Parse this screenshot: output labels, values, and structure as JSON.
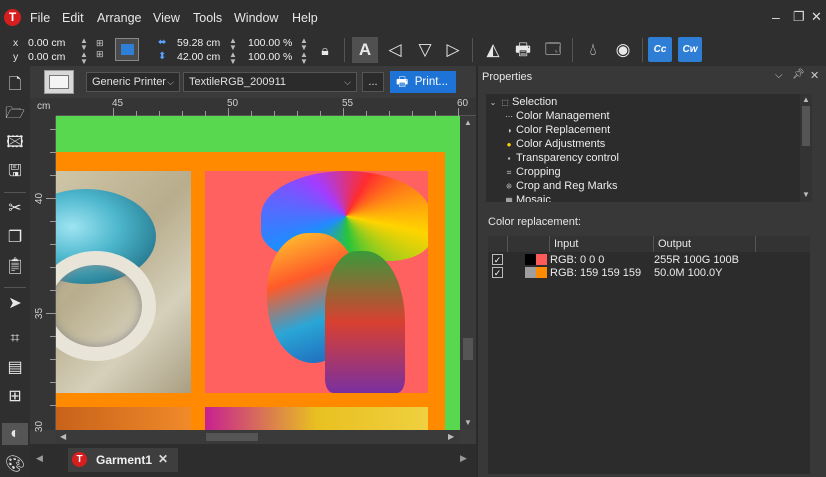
{
  "menu": {
    "items": [
      "File",
      "Edit",
      "Arrange",
      "View",
      "Tools",
      "Window",
      "Help"
    ]
  },
  "window_controls": {
    "restore": "▫",
    "close": "✕"
  },
  "toolbar": {
    "x_label": "x",
    "x_value": "0.00 cm",
    "y_label": "y",
    "y_value": "0.00 cm",
    "width_value": "59.28 cm",
    "height_value": "42.00 cm",
    "scale_x": "100.00 %",
    "scale_y": "100.00 %",
    "cc_label": "Cc",
    "cw_label": "Cw"
  },
  "printbar": {
    "printer": "Generic Printer",
    "profile": "TextileRGB_200911",
    "more_label": "...",
    "print_label": "Print..."
  },
  "ruler": {
    "unit": "cm",
    "top_ticks": [
      "45",
      "50",
      "55",
      "60"
    ],
    "left_ticks": [
      "40",
      "35",
      "30"
    ]
  },
  "document_tab": {
    "name": "Garment1"
  },
  "properties": {
    "title": "Properties",
    "tree": [
      {
        "label": "Selection",
        "icon": "selection-icon",
        "root": true
      },
      {
        "label": "Color Management",
        "icon": "color-management-icon"
      },
      {
        "label": "Color Replacement",
        "icon": "color-replacement-icon"
      },
      {
        "label": "Color Adjustments",
        "icon": "color-adjustments-icon"
      },
      {
        "label": "Transparency control",
        "icon": "transparency-icon"
      },
      {
        "label": "Cropping",
        "icon": "cropping-icon"
      },
      {
        "label": "Crop and Reg Marks",
        "icon": "crop-marks-icon"
      },
      {
        "label": "Mosaic",
        "icon": "mosaic-icon"
      }
    ],
    "color_replacement_label": "Color replacement:",
    "columns": [
      "Input",
      "Output"
    ],
    "rows": [
      {
        "checked": true,
        "input_color": "#000000",
        "output_color": "#ff5a5a",
        "input": "RGB: 0 0 0",
        "output": "255R 100G 100B"
      },
      {
        "checked": true,
        "input_color": "#9f9f9f",
        "output_color": "#ff8c00",
        "input": "RGB: 159 159 159",
        "output": "50.0M 100.0Y"
      }
    ]
  },
  "colors": {
    "accent": "#1e74d6",
    "canvas_bg": "#58d84f",
    "frame_orange": "#ff8a00",
    "portrait_bg": "#ff6060",
    "brand": "#d71e1e"
  }
}
